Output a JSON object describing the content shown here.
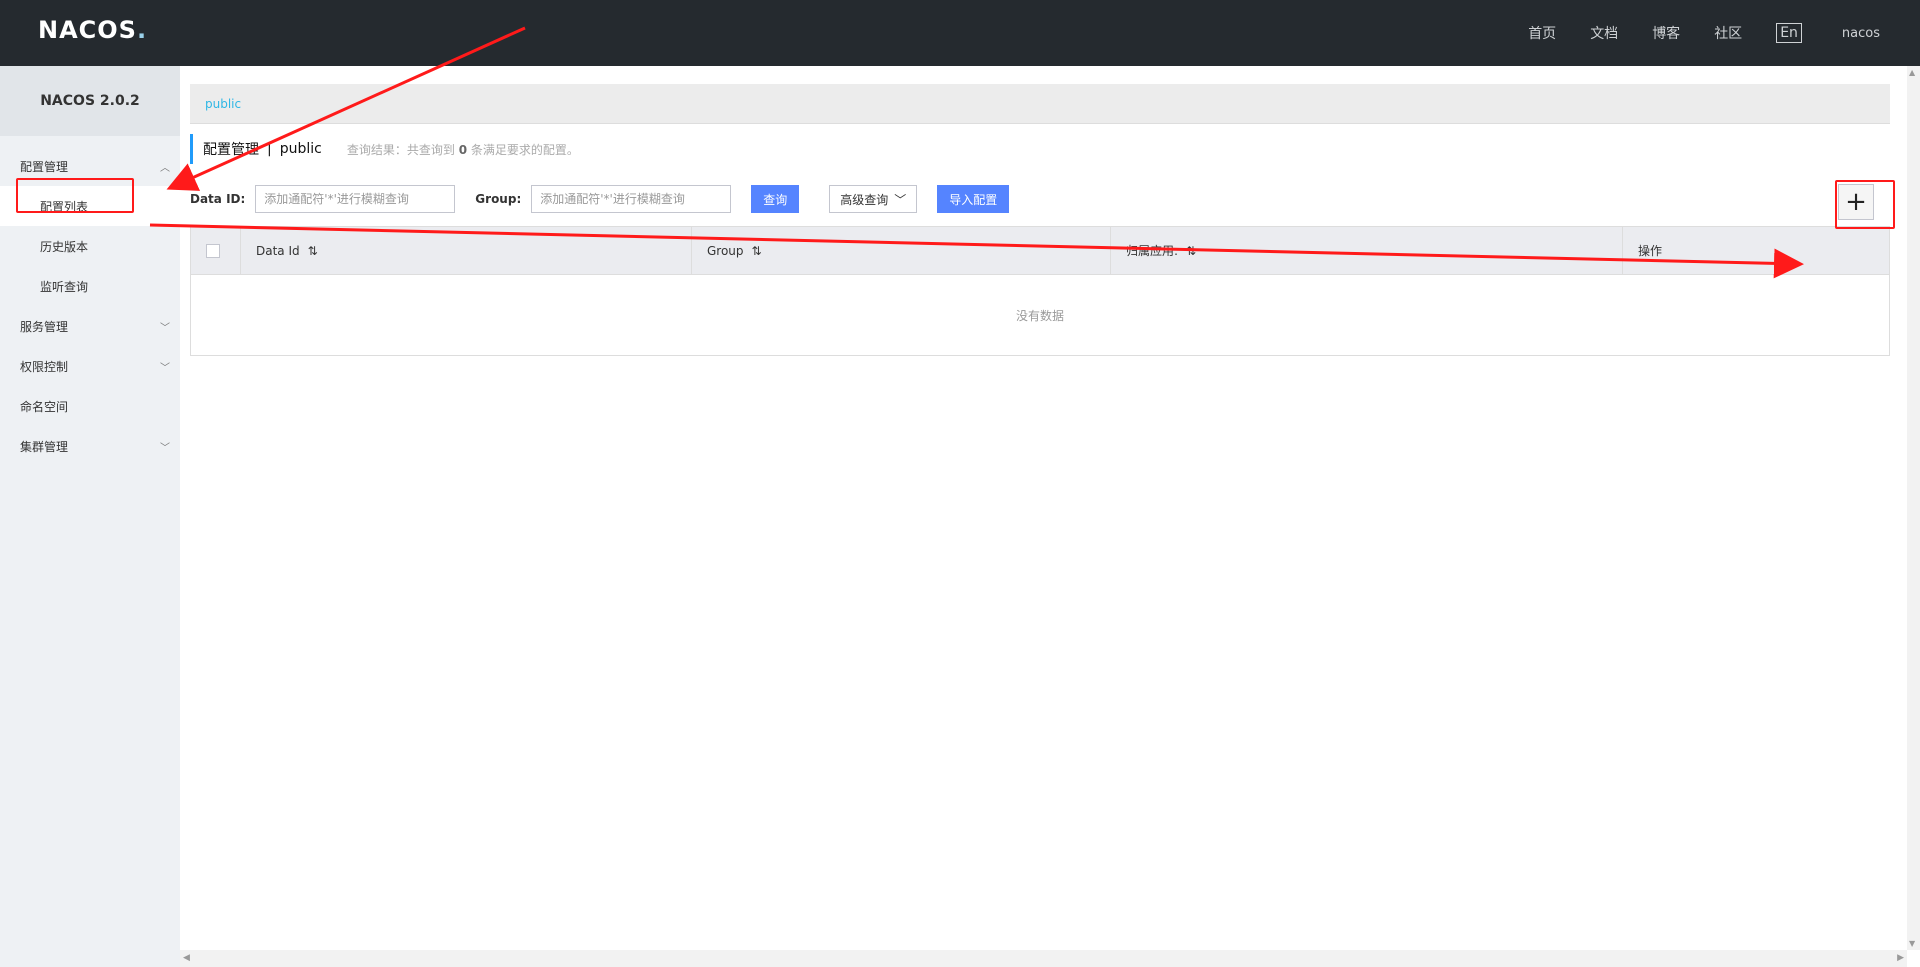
{
  "header": {
    "logo": "NACOS",
    "nav": [
      "首页",
      "文档",
      "博客",
      "社区"
    ],
    "lang": "En",
    "user": "nacos"
  },
  "sidebar": {
    "version": "NACOS 2.0.2",
    "groups": [
      {
        "label": "配置管理",
        "expanded": true,
        "items": [
          {
            "label": "配置列表",
            "active": true
          },
          {
            "label": "历史版本"
          },
          {
            "label": "监听查询"
          }
        ]
      },
      {
        "label": "服务管理",
        "expanded": false
      },
      {
        "label": "权限控制",
        "expanded": false
      },
      {
        "label": "命名空间"
      },
      {
        "label": "集群管理",
        "expanded": false
      }
    ]
  },
  "namespace": {
    "current": "public"
  },
  "page": {
    "title": "配置管理",
    "separator": "|",
    "namespace": "public",
    "result_prefix": "查询结果：共查询到",
    "result_count": "0",
    "result_suffix": "条满足要求的配置。"
  },
  "search": {
    "dataid_label": "Data ID:",
    "dataid_placeholder": "添加通配符'*'进行模糊查询",
    "group_label": "Group:",
    "group_placeholder": "添加通配符'*'进行模糊查询",
    "query_btn": "查询",
    "advanced_btn": "高级查询",
    "import_btn": "导入配置",
    "add_btn": "+"
  },
  "table": {
    "columns": [
      "Data Id",
      "Group",
      "归属应用:",
      "操作"
    ],
    "empty_text": "没有数据"
  },
  "annotation_colors": {
    "red": "#ff1a1a"
  }
}
